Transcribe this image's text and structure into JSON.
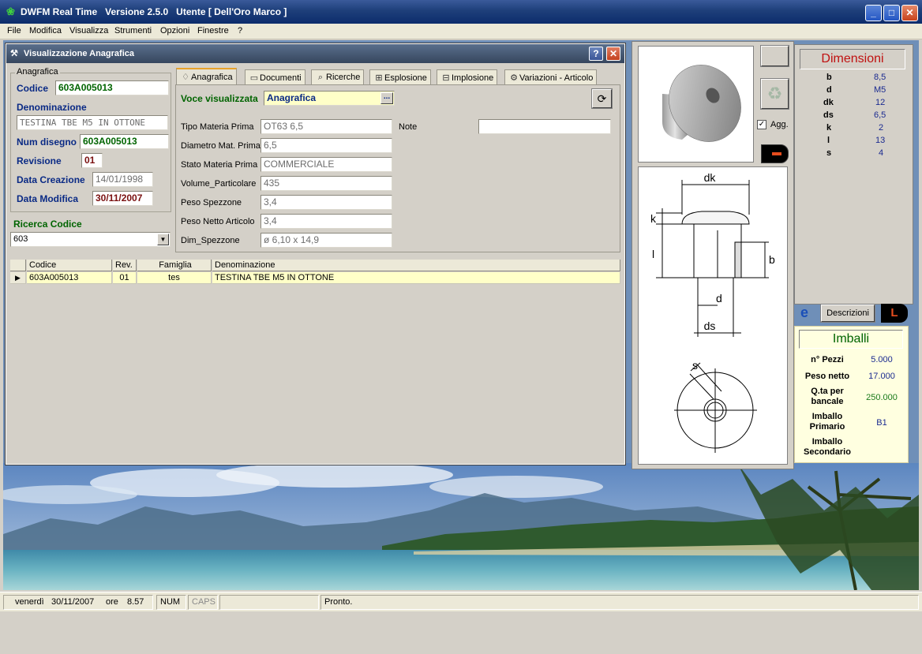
{
  "window": {
    "title": "DWFM Real Time   Versione 2.5.0   Utente [ Dell'Oro Marco ]",
    "minimize": "_",
    "maximize": "□",
    "close": "✕"
  },
  "menu": [
    "File",
    "Modifica",
    "Visualizza",
    "Strumenti",
    "Opzioni",
    "Finestre",
    "?"
  ],
  "child": {
    "title": "Visualizzazione Anagrafica",
    "help": "?",
    "close": "✕"
  },
  "anagrafica": {
    "legend": "Anagrafica",
    "codice_label": "Codice",
    "codice_value": "603A005013",
    "denominazione_label": "Denominazione",
    "denominazione_value": "TESTINA TBE M5 IN OTTONE",
    "num_disegno_label": "Num disegno",
    "num_disegno_value": "603A005013",
    "revisione_label": "Revisione",
    "revisione_value": "01",
    "data_creazione_label": "Data Creazione",
    "data_creazione_value": "14/01/1998",
    "data_modifica_label": "Data Modifica",
    "data_modifica_value": "30/11/2007"
  },
  "ricerca": {
    "label": "Ricerca Codice",
    "value": "603"
  },
  "tabs": [
    {
      "label": "Anagrafica",
      "icon": "lightbulb-icon",
      "glyph": "💡"
    },
    {
      "label": "Documenti",
      "icon": "document-icon",
      "glyph": "⊟"
    },
    {
      "label": "Ricerche",
      "icon": "search-icon",
      "glyph": "⊕"
    },
    {
      "label": "Esplosione",
      "icon": "tree-icon",
      "glyph": "⊞"
    },
    {
      "label": "Implosione",
      "icon": "tree-icon",
      "glyph": "⊞"
    },
    {
      "label": "Variazioni - Articolo",
      "icon": "wizard-icon",
      "glyph": "⚙"
    }
  ],
  "voce": {
    "label": "Voce visualizzata",
    "value": "Anagrafica",
    "button": "..."
  },
  "props": [
    {
      "label": "Tipo Materia Prima",
      "value": "OT63 6,5"
    },
    {
      "label": "Diametro Mat. Prima",
      "value": "6,5"
    },
    {
      "label": "Stato Materia Prima",
      "value": "COMMERCIALE"
    },
    {
      "label": "Volume_Particolare",
      "value": "435"
    },
    {
      "label": "Peso Spezzone",
      "value": "3,4"
    },
    {
      "label": "Peso Netto Articolo",
      "value": "3,4"
    },
    {
      "label": "Dim_Spezzone",
      "value": "ø 6,10 x 14,9"
    }
  ],
  "note": {
    "label": "Note",
    "value": ""
  },
  "grid": {
    "headers": [
      "Codice",
      "Rev.",
      "Famiglia",
      "Denominazione"
    ],
    "rows": [
      {
        "codice": "603A005013",
        "rev": "01",
        "famiglia": "tes",
        "denominazione": "TESTINA TBE M5 IN OTTONE"
      }
    ]
  },
  "preview": {
    "agg_label": "Agg.",
    "agg_checked": true
  },
  "drawing": {
    "dk": "dk",
    "k": "k",
    "l": "l",
    "b": "b",
    "d": "d",
    "ds": "ds",
    "s": "s"
  },
  "dimensioni": {
    "title": "Dimensioni",
    "rows": [
      {
        "label": "b",
        "value": "8,5"
      },
      {
        "label": "d",
        "value": "M5"
      },
      {
        "label": "dk",
        "value": "12"
      },
      {
        "label": "ds",
        "value": "6,5"
      },
      {
        "label": "k",
        "value": "2"
      },
      {
        "label": "l",
        "value": "13"
      },
      {
        "label": "s",
        "value": "4"
      }
    ]
  },
  "buttons": {
    "descrizioni": "Descrizioni",
    "l_label": "L"
  },
  "imballi": {
    "title": "Imballi",
    "rows": [
      {
        "label": "n° Pezzi",
        "value": "5.000"
      },
      {
        "label": "Peso netto",
        "value": "17.000"
      },
      {
        "label": "Q.ta per bancale",
        "value": "250.000"
      },
      {
        "label": "Imballo Primario",
        "value": "B1"
      },
      {
        "label": "Imballo Secondario",
        "value": ""
      }
    ]
  },
  "status": {
    "day": "venerdì",
    "date": "30/11/2007",
    "ore_label": "ore",
    "time": "8.57",
    "num": "NUM",
    "caps": "CAPS",
    "message": "Pronto."
  }
}
